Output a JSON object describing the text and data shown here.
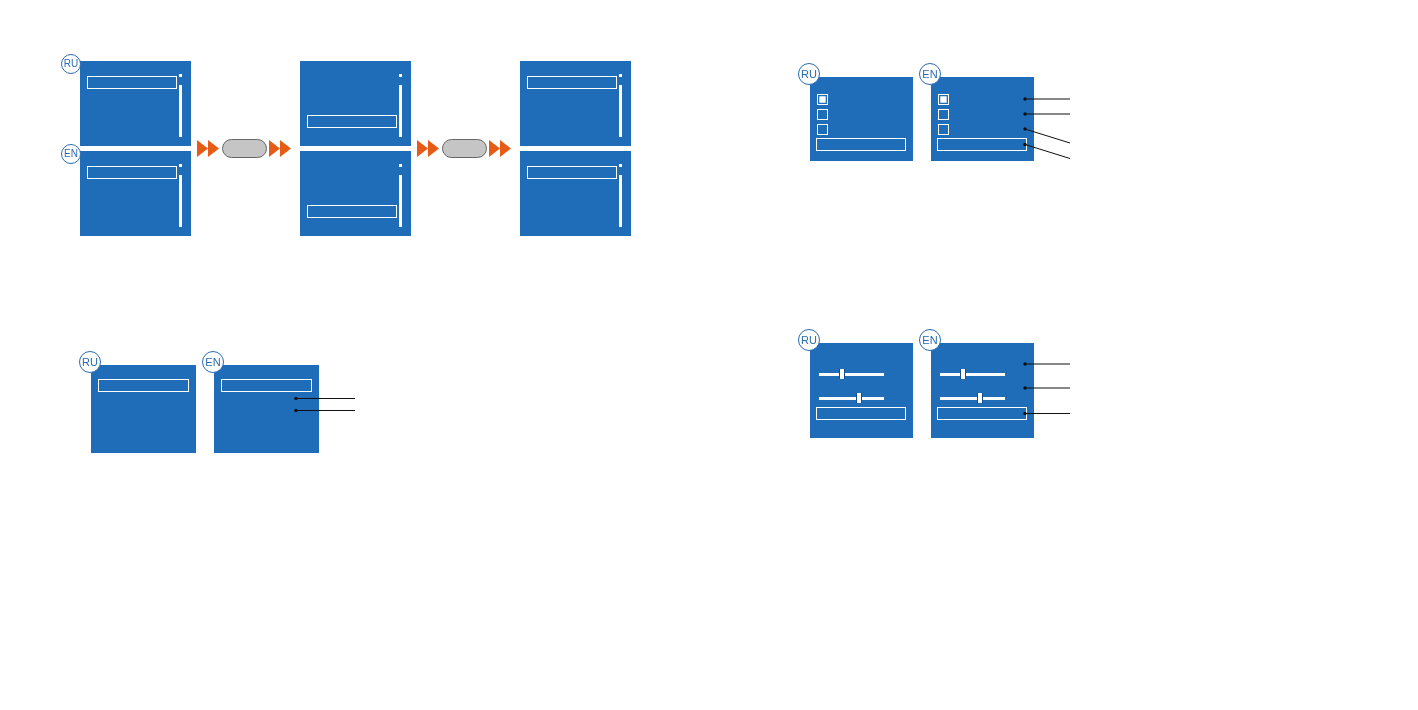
{
  "pages": [
    {
      "figures": [
        {
          "kind": "sequence",
          "columns": [
            {
              "kind": "screens",
              "screens": [
                {
                  "badge": "RU",
                  "scrollbar": true,
                  "rows": [
                    {
                      "selected": true
                    },
                    {
                      "selected": false
                    },
                    {
                      "selected": false
                    },
                    {
                      "selected": false
                    }
                  ]
                },
                {
                  "badge": "EN",
                  "scrollbar": true,
                  "rows": [
                    {
                      "selected": true
                    },
                    {
                      "selected": false
                    },
                    {
                      "selected": false
                    },
                    {
                      "selected": false
                    }
                  ]
                }
              ]
            },
            {
              "kind": "keypress"
            },
            {
              "kind": "screens",
              "screens": [
                {
                  "scrollbar": true,
                  "rows": [
                    {
                      "selected": false
                    },
                    {
                      "selected": false
                    },
                    {
                      "selected": false
                    },
                    {
                      "selected": true
                    }
                  ]
                },
                {
                  "scrollbar": true,
                  "rows": [
                    {
                      "selected": false
                    },
                    {
                      "selected": false
                    },
                    {
                      "selected": false
                    },
                    {
                      "selected": true
                    }
                  ]
                }
              ]
            },
            {
              "kind": "keypress"
            },
            {
              "kind": "screens",
              "screens": [
                {
                  "scrollbar": true,
                  "rows": [
                    {
                      "selected": true
                    },
                    {
                      "selected": false
                    },
                    {
                      "selected": false
                    },
                    {
                      "selected": false
                    }
                  ]
                },
                {
                  "scrollbar": true,
                  "rows": [
                    {
                      "selected": true
                    },
                    {
                      "selected": false
                    },
                    {
                      "selected": false
                    },
                    {
                      "selected": false
                    }
                  ]
                }
              ]
            }
          ]
        },
        {
          "kind": "pair",
          "screens": [
            {
              "badge": "RU",
              "rows": [
                {
                  "kind": "field",
                  "callout": false
                },
                {
                  "kind": "blank",
                  "callout": false
                },
                {
                  "kind": "blank",
                  "callout": false
                }
              ]
            },
            {
              "badge": "EN",
              "rows": [
                {
                  "kind": "field",
                  "callout": false
                },
                {
                  "kind": "blank",
                  "callout": true,
                  "sloped": false
                },
                {
                  "kind": "blank",
                  "callout": true,
                  "sloped": false
                }
              ]
            }
          ]
        }
      ]
    },
    {
      "figures": [
        {
          "kind": "pair",
          "screens": [
            {
              "badge": "RU",
              "rows": [
                {
                  "kind": "checkbox",
                  "checked": true,
                  "callout": false
                },
                {
                  "kind": "checkbox",
                  "checked": false,
                  "callout": false
                },
                {
                  "kind": "checkbox",
                  "checked": false,
                  "callout": false
                },
                {
                  "kind": "field",
                  "callout": false
                }
              ]
            },
            {
              "badge": "EN",
              "rows": [
                {
                  "kind": "checkbox",
                  "checked": true,
                  "callout": true,
                  "sloped": false
                },
                {
                  "kind": "checkbox",
                  "checked": false,
                  "callout": true,
                  "sloped": false
                },
                {
                  "kind": "checkbox",
                  "checked": false,
                  "callout": true,
                  "sloped": true
                },
                {
                  "kind": "field",
                  "callout": true,
                  "sloped": true
                }
              ]
            }
          ]
        },
        {
          "kind": "pair",
          "screens": [
            {
              "badge": "RU",
              "rows": [
                {
                  "kind": "slider",
                  "level": 0.35,
                  "callout": false
                },
                {
                  "kind": "slider",
                  "level": 0.65,
                  "callout": false
                },
                {
                  "kind": "field",
                  "callout": false
                }
              ]
            },
            {
              "badge": "EN",
              "rows": [
                {
                  "kind": "slider",
                  "level": 0.35,
                  "callout": true,
                  "sloped": false
                },
                {
                  "kind": "slider",
                  "level": 0.65,
                  "callout": true,
                  "sloped": false
                },
                {
                  "kind": "field",
                  "callout": true,
                  "sloped": false
                }
              ]
            }
          ]
        }
      ]
    }
  ]
}
